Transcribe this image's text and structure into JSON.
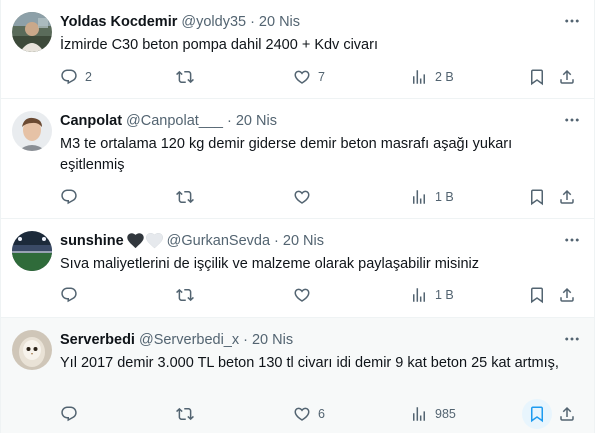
{
  "tweets": [
    {
      "name": "Yoldas Kocdemir",
      "handle": "@yoldy35",
      "sep": "·",
      "time": "20 Nis",
      "text": "İzmirde C30 beton pompa dahil 2400 + Kdv civarı",
      "replies": "2",
      "retweets": "",
      "likes": "7",
      "views": "2 B"
    },
    {
      "name": "Canpolat",
      "handle": "@Canpolat___",
      "sep": "·",
      "time": "20 Nis",
      "text": "M3 te ortalama 120 kg demir giderse demir beton masrafı aşağı yukarı eşitlenmiş",
      "replies": "",
      "retweets": "",
      "likes": "",
      "views": "1 B"
    },
    {
      "name": "sunshine",
      "handle": "@GurkanSevda",
      "sep": "·",
      "time": "20 Nis",
      "text": "Sıva maliyetlerini de işçilik ve malzeme olarak paylaşabilir misiniz",
      "replies": "",
      "retweets": "",
      "likes": "",
      "views": "1 B",
      "name_icons": [
        "black-heart-icon",
        "white-heart-icon"
      ]
    },
    {
      "name": "Serverbedi",
      "handle": "@Serverbedi_x",
      "sep": "·",
      "time": "20 Nis",
      "text": "Yıl 2017 demir 3.000 TL beton 130 tl civarı idi demir 9 kat beton 25 kat artmış,",
      "replies": "",
      "retweets": "",
      "likes": "6",
      "views": "985"
    }
  ],
  "colors": {
    "text": "#0f1419",
    "secondary": "#536471",
    "border": "#eff3f4",
    "hover_bg": "#f7f9f9",
    "accent": "#1d9bf0"
  }
}
